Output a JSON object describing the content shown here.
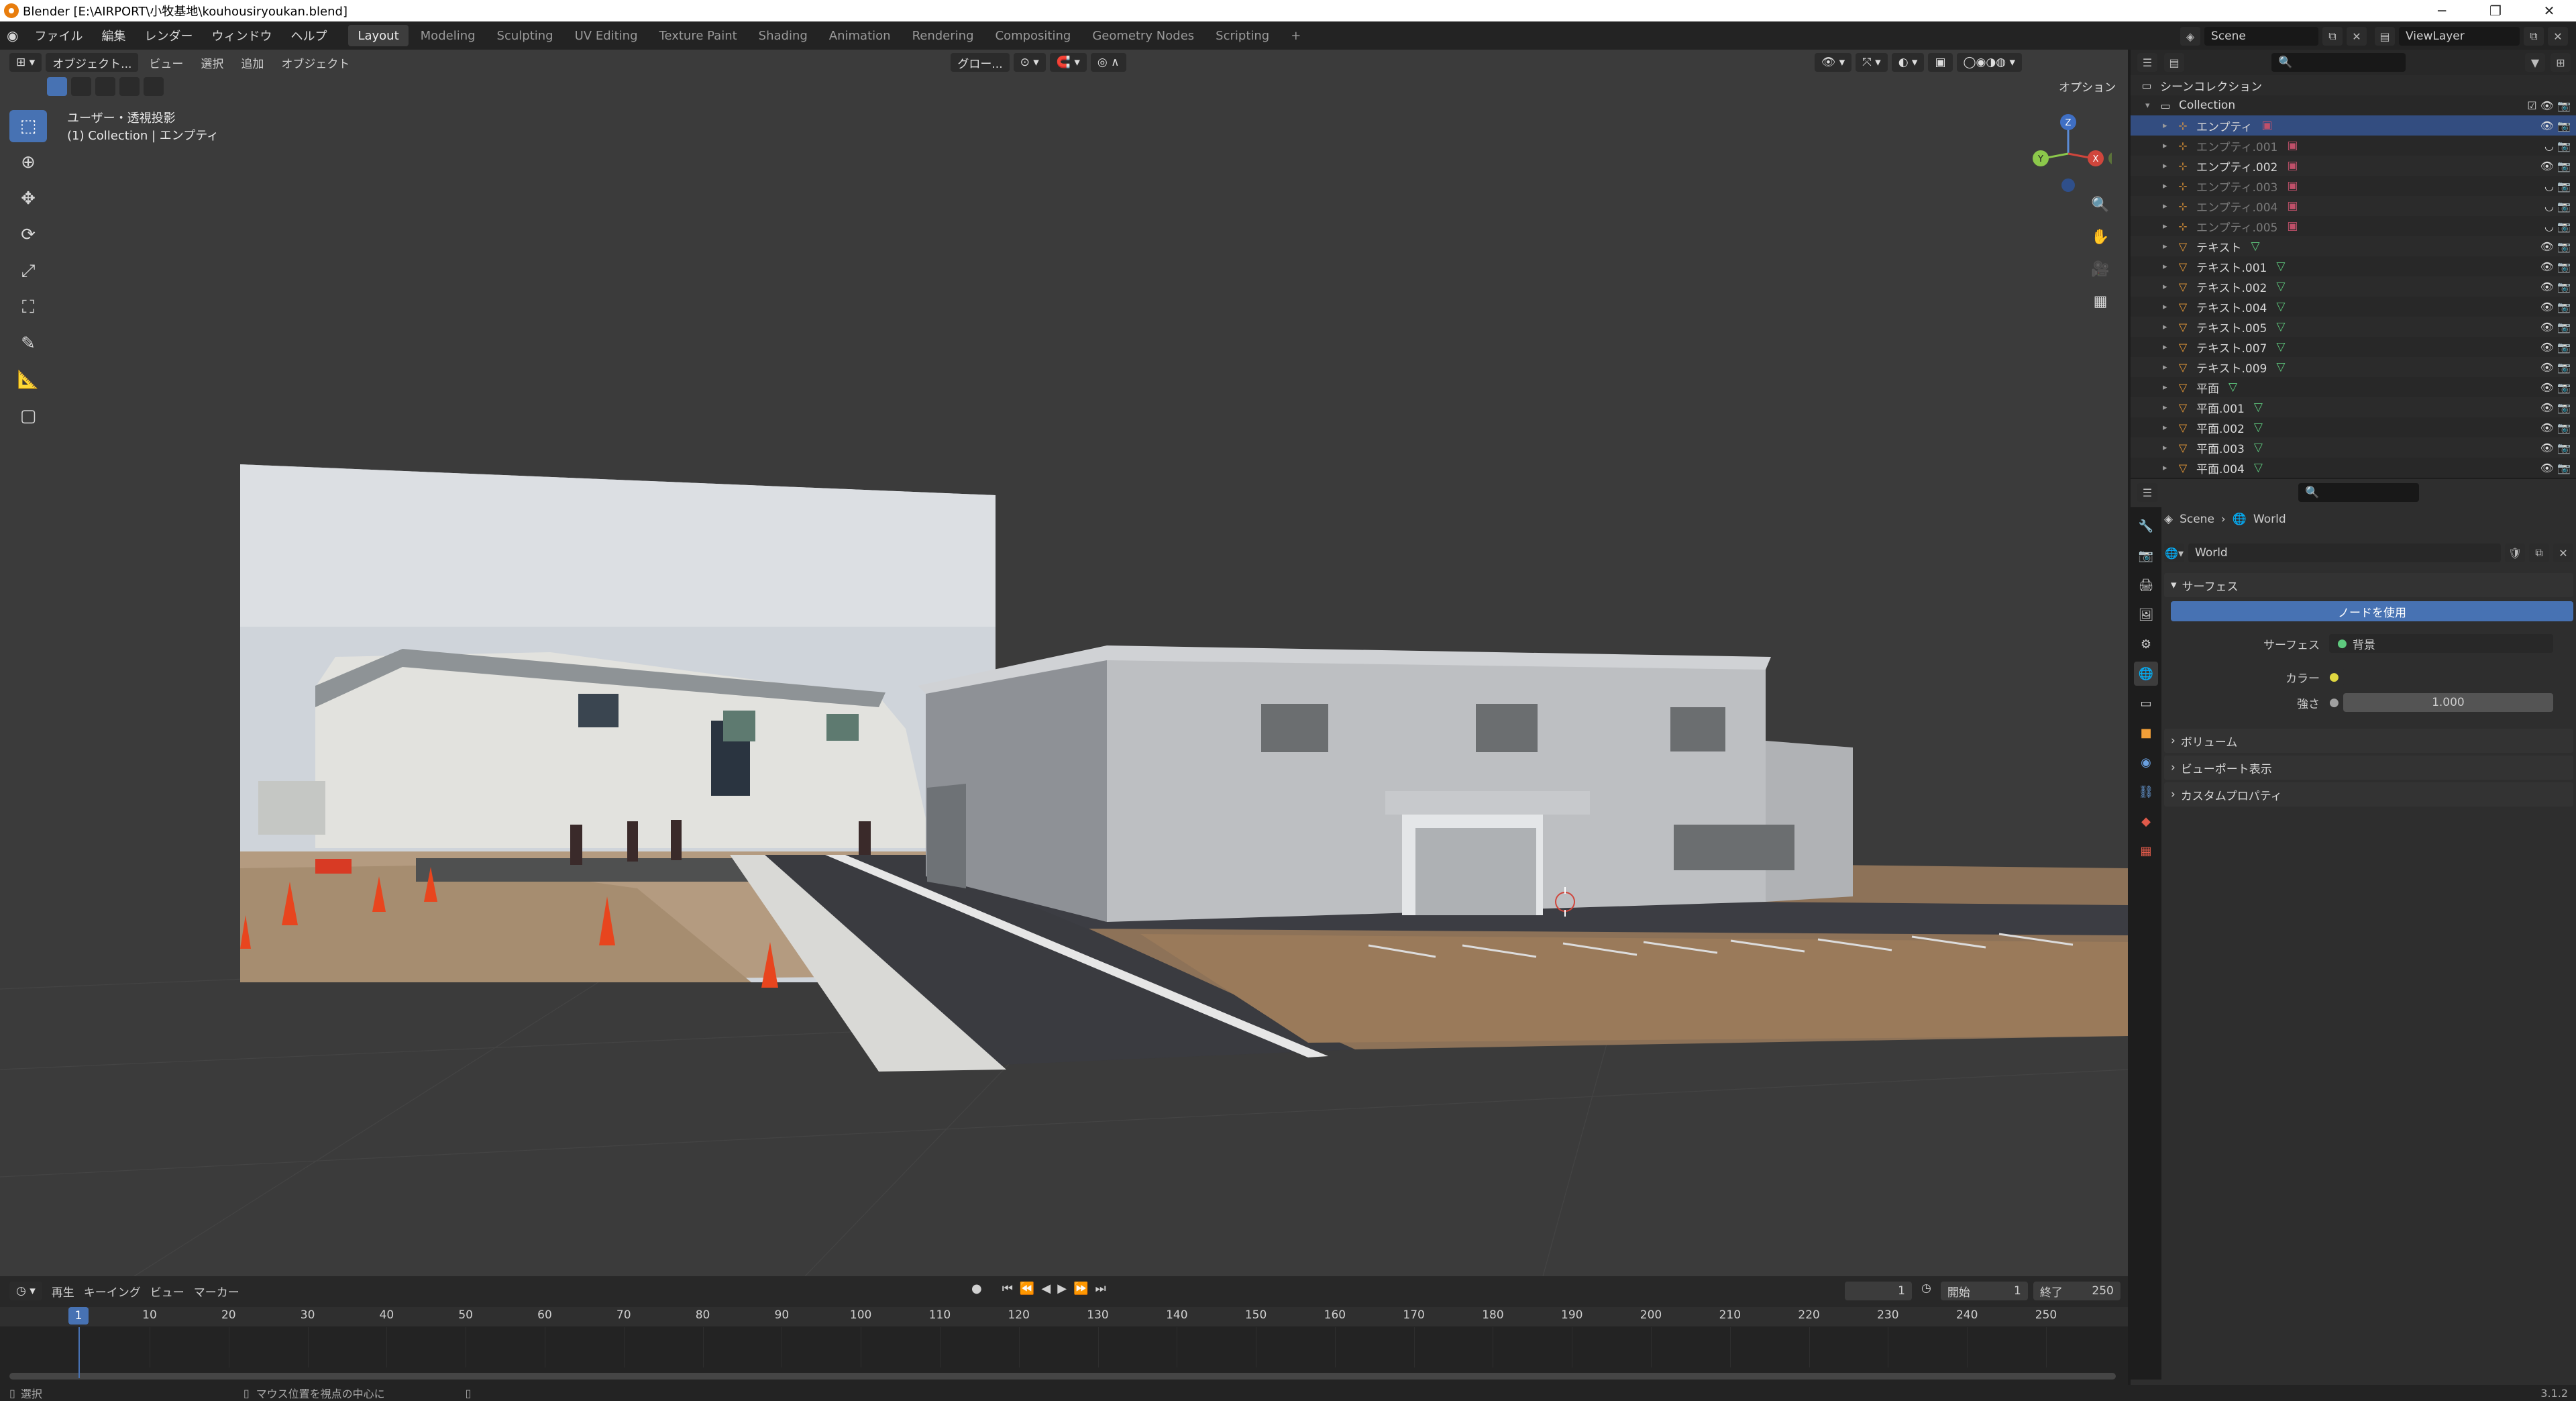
{
  "window": {
    "title": "Blender [E:\\AIRPORT\\小牧基地\\kouhousiryoukan.blend]",
    "minimize": "─",
    "maximize": "❐",
    "close": "✕"
  },
  "menus": [
    "ファイル",
    "編集",
    "レンダー",
    "ウィンドウ",
    "ヘルプ"
  ],
  "workspaces": [
    "Layout",
    "Modeling",
    "Sculpting",
    "UV Editing",
    "Texture Paint",
    "Shading",
    "Animation",
    "Rendering",
    "Compositing",
    "Geometry Nodes",
    "Scripting"
  ],
  "workspace_add": "+",
  "scene": {
    "name": "Scene",
    "view_layer": "ViewLayer"
  },
  "viewport": {
    "mode": "オブジェクト...",
    "menu": [
      "ビュー",
      "選択",
      "追加",
      "オブジェクト"
    ],
    "transform": "グロー...",
    "options": "オプション",
    "info_line1": "ユーザー・透視投影",
    "info_line2": "(1) Collection | エンプティ",
    "gizmo": {
      "z": "Z",
      "x": "X",
      "y": "Y"
    }
  },
  "timeline": {
    "menu": [
      "再生",
      "キーイング",
      "ビュー",
      "マーカー"
    ],
    "current_frame": "1",
    "start_label": "開始",
    "start": "1",
    "end_label": "終了",
    "end": "250",
    "ticks": [
      "1",
      "10",
      "20",
      "30",
      "40",
      "50",
      "60",
      "70",
      "80",
      "90",
      "100",
      "110",
      "120",
      "130",
      "140",
      "150",
      "160",
      "170",
      "180",
      "190",
      "200",
      "210",
      "220",
      "230",
      "240",
      "250"
    ]
  },
  "statusbar": {
    "left": "選択",
    "middle": "マウス位置を視点の中心に",
    "version": "3.1.2"
  },
  "outliner": {
    "root": "シーンコレクション",
    "collection": "Collection",
    "items": [
      {
        "name": "エンプティ",
        "type": "empty",
        "selected": true,
        "dim": false
      },
      {
        "name": "エンプティ.001",
        "type": "empty",
        "selected": false,
        "dim": true
      },
      {
        "name": "エンプティ.002",
        "type": "empty",
        "selected": false,
        "dim": false
      },
      {
        "name": "エンプティ.003",
        "type": "empty",
        "selected": false,
        "dim": true
      },
      {
        "name": "エンプティ.004",
        "type": "empty",
        "selected": false,
        "dim": true
      },
      {
        "name": "エンプティ.005",
        "type": "empty",
        "selected": false,
        "dim": true
      },
      {
        "name": "テキスト",
        "type": "mesh",
        "selected": false,
        "dim": false
      },
      {
        "name": "テキスト.001",
        "type": "mesh",
        "selected": false,
        "dim": false
      },
      {
        "name": "テキスト.002",
        "type": "mesh",
        "selected": false,
        "dim": false
      },
      {
        "name": "テキスト.004",
        "type": "mesh",
        "selected": false,
        "dim": false
      },
      {
        "name": "テキスト.005",
        "type": "mesh",
        "selected": false,
        "dim": false
      },
      {
        "name": "テキスト.007",
        "type": "mesh",
        "selected": false,
        "dim": false
      },
      {
        "name": "テキスト.009",
        "type": "mesh",
        "selected": false,
        "dim": false
      },
      {
        "name": "平面",
        "type": "mesh",
        "selected": false,
        "dim": false
      },
      {
        "name": "平面.001",
        "type": "mesh",
        "selected": false,
        "dim": false
      },
      {
        "name": "平面.002",
        "type": "mesh",
        "selected": false,
        "dim": false
      },
      {
        "name": "平面.003",
        "type": "mesh",
        "selected": false,
        "dim": false
      },
      {
        "name": "平面.004",
        "type": "mesh",
        "selected": false,
        "dim": false
      }
    ]
  },
  "properties": {
    "breadcrumb": [
      "Scene",
      "World"
    ],
    "world_name": "World",
    "surface_panel": "サーフェス",
    "use_nodes": "ノードを使用",
    "surface_label": "サーフェス",
    "surface_value": "背景",
    "color_label": "カラー",
    "strength_label": "強さ",
    "strength_value": "1.000",
    "panels": [
      "ボリューム",
      "ビューポート表示",
      "カスタムプロパティ"
    ]
  },
  "colors": {
    "accent": "#4772b3",
    "selected_row": "#334d80",
    "mesh_icon": "#f29f38",
    "empty_icon": "#f29f38",
    "data_icon": "#5ec97e"
  }
}
